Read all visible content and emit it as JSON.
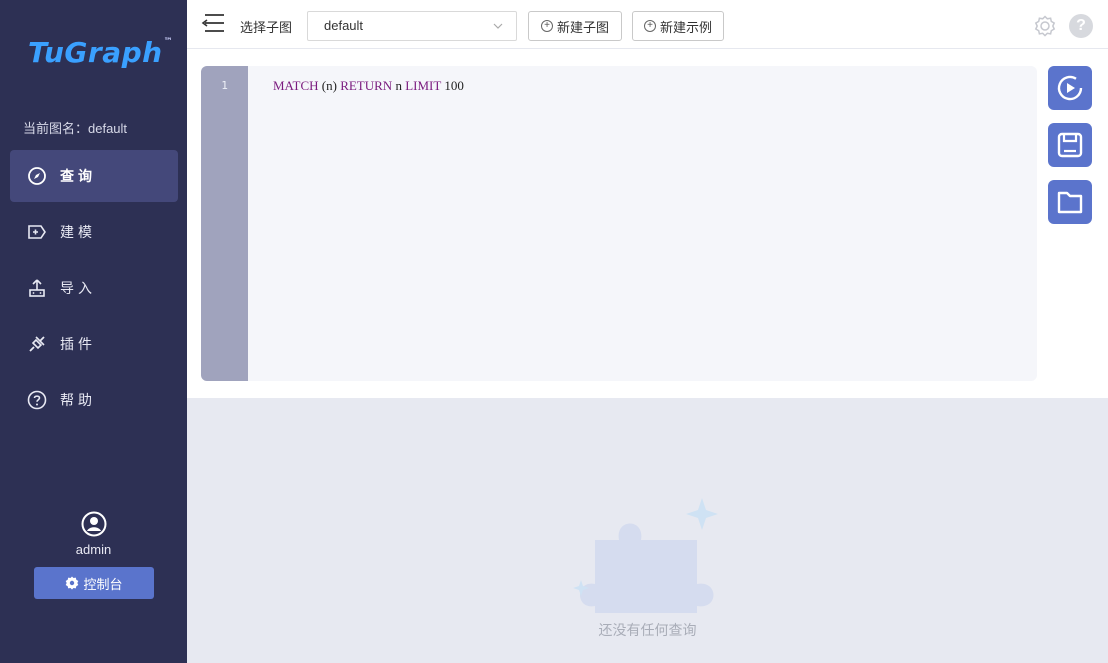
{
  "sidebar": {
    "logo": "TuGraph",
    "logo_tm": "™",
    "current_graph": "当前图名：default",
    "items": [
      {
        "label": "查询",
        "icon": "compass-icon",
        "active": true
      },
      {
        "label": "建模",
        "icon": "model-tag-icon",
        "active": false
      },
      {
        "label": "导入",
        "icon": "upload-icon",
        "active": false
      },
      {
        "label": "插件",
        "icon": "plugin-icon",
        "active": false
      },
      {
        "label": "帮助",
        "icon": "question-circle-icon",
        "active": false
      }
    ],
    "user": {
      "name": "admin",
      "icon": "user-avatar-icon"
    },
    "console_label": "控制台"
  },
  "header": {
    "select_label": "选择子图",
    "selected_graph": "default",
    "new_subgraph": "新建子图",
    "new_example": "新建示例"
  },
  "editor": {
    "line_number": "1",
    "tokens": [
      "MATCH",
      " (n) ",
      "RETURN",
      " n ",
      "LIMIT",
      " 100"
    ]
  },
  "results": {
    "empty_text": "还没有任何查询"
  },
  "colors": {
    "sidebar_bg": "#2d3054",
    "accent": "#5b74cc",
    "keyword": "#7a1a7e"
  }
}
